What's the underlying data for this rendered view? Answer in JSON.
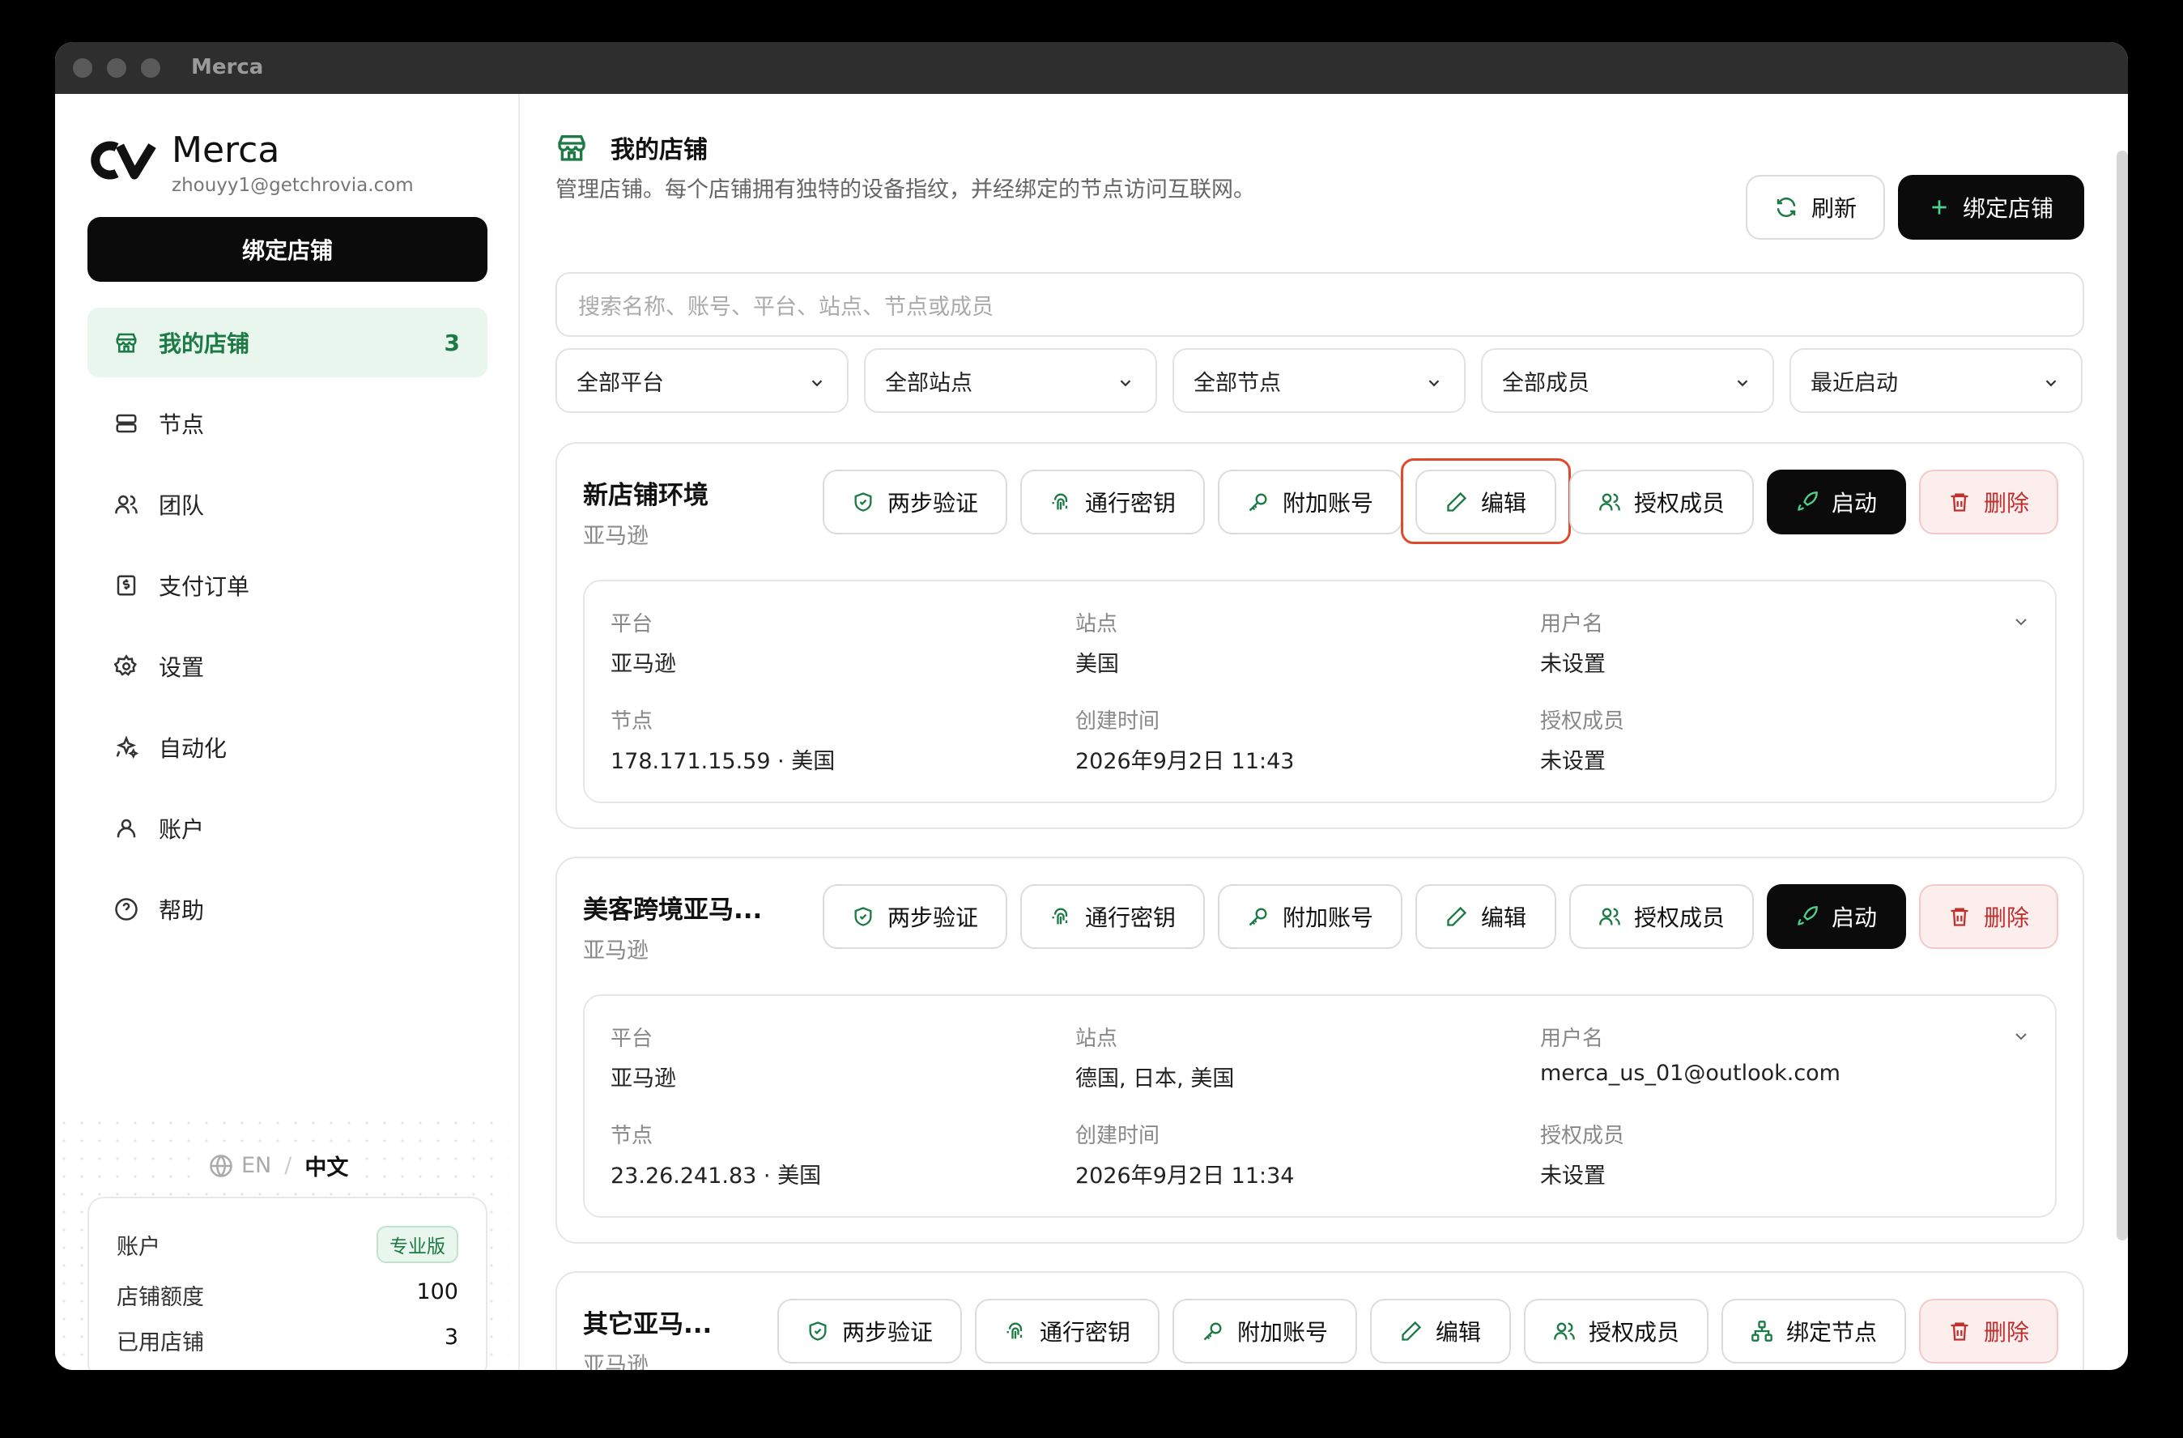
{
  "window": {
    "title": "Merca"
  },
  "sidebar": {
    "brand": "Merca",
    "email": "zhouyy1@getchrovia.com",
    "bind_button": "绑定店铺",
    "items": [
      {
        "label": "我的店铺",
        "count": "3",
        "icon": "store-icon"
      },
      {
        "label": "节点",
        "icon": "server-icon"
      },
      {
        "label": "团队",
        "icon": "users-icon"
      },
      {
        "label": "支付订单",
        "icon": "receipt-icon"
      },
      {
        "label": "设置",
        "icon": "gear-icon"
      },
      {
        "label": "自动化",
        "icon": "sparkles-icon"
      },
      {
        "label": "账户",
        "icon": "user-icon"
      },
      {
        "label": "帮助",
        "icon": "help-icon"
      }
    ],
    "lang": {
      "en": "EN",
      "sep": "/",
      "zh": "中文"
    },
    "account": {
      "title": "账户",
      "plan": "专业版",
      "quota_label": "店铺额度",
      "quota_value": "100",
      "used_label": "已用店铺",
      "used_value": "3"
    }
  },
  "header": {
    "title": "我的店铺",
    "description": "管理店铺。每个店铺拥有独特的设备指纹，并经绑定的节点访问互联网。",
    "refresh": "刷新",
    "bind": "绑定店铺"
  },
  "search": {
    "placeholder": "搜索名称、账号、平台、站点、节点或成员"
  },
  "filters": [
    "全部平台",
    "全部站点",
    "全部节点",
    "全部成员",
    "最近启动"
  ],
  "labels": {
    "two_factor": "两步验证",
    "passkey": "通行密钥",
    "extra_account": "附加账号",
    "edit": "编辑",
    "authorize": "授权成员",
    "launch": "启动",
    "bind_node": "绑定节点",
    "delete": "删除",
    "platform": "平台",
    "site": "站点",
    "username": "用户名",
    "node": "节点",
    "created": "创建时间",
    "members": "授权成员"
  },
  "stores": [
    {
      "name": "新店铺环境",
      "platform": "亚马逊",
      "site": "美国",
      "username": "未设置",
      "node": "178.171.15.59 · 美国",
      "created": "2026年9月2日 11:43",
      "members": "未设置"
    },
    {
      "name": "美客跨境亚马...",
      "platform": "亚马逊",
      "site": "德国, 日本, 美国",
      "username": "merca_us_01@outlook.com",
      "node": "23.26.241.83 · 美国",
      "created": "2026年9月2日 11:34",
      "members": "未设置"
    },
    {
      "name": "其它亚马...",
      "platform": "亚马逊"
    }
  ],
  "colors": {
    "accent": "#1c7a45",
    "danger": "#c0312e",
    "highlight": "#e04a2c"
  }
}
